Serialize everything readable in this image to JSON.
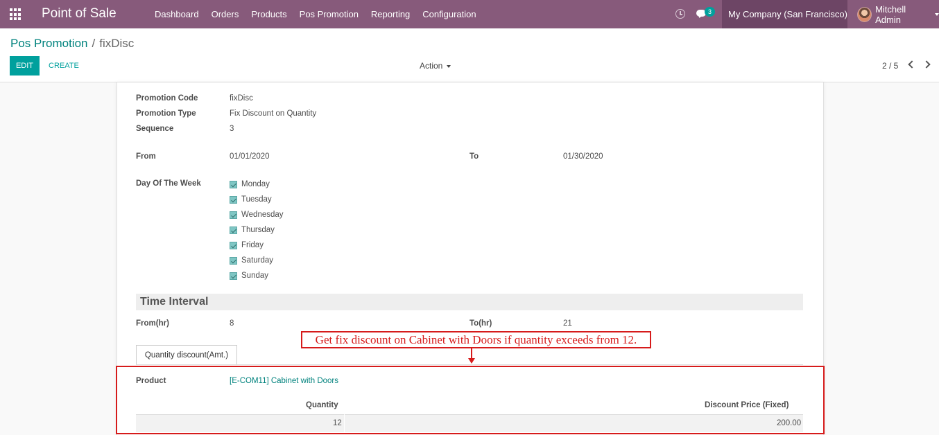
{
  "navbar": {
    "brand": "Point of Sale",
    "menu": [
      "Dashboard",
      "Orders",
      "Products",
      "Pos Promotion",
      "Reporting",
      "Configuration"
    ],
    "chat_count": "3",
    "company": "My Company (San Francisco)",
    "user": "Mitchell Admin"
  },
  "control": {
    "breadcrumb_parent": "Pos Promotion",
    "breadcrumb_separator": "/",
    "breadcrumb_current": "fixDisc",
    "edit_label": "EDIT",
    "create_label": "CREATE",
    "action_label": "Action",
    "pager": "2 / 5"
  },
  "form": {
    "promotion_code_label": "Promotion Code",
    "promotion_code": "fixDisc",
    "promotion_type_label": "Promotion Type",
    "promotion_type": "Fix Discount on Quantity",
    "sequence_label": "Sequence",
    "sequence": "3",
    "from_label": "From",
    "from": "01/01/2020",
    "to_label": "To",
    "to": "01/30/2020",
    "day_of_week_label": "Day Of The Week",
    "days": [
      "Monday",
      "Tuesday",
      "Wednesday",
      "Thursday",
      "Friday",
      "Saturday",
      "Sunday"
    ],
    "time_interval_title": "Time Interval",
    "from_hr_label": "From(hr)",
    "from_hr": "8",
    "to_hr_label": "To(hr)",
    "to_hr": "21"
  },
  "tab": {
    "label": "Quantity discount(Amt.)",
    "product_label": "Product",
    "product": "[E-COM11] Cabinet with Doors",
    "columns": [
      "Quantity",
      "Discount Price (Fixed)"
    ],
    "rows": [
      {
        "quantity": "12",
        "discount": "200.00"
      }
    ]
  },
  "annotation": {
    "text": "Get fix discount on Cabinet with Doors if quantity exceeds from 12."
  },
  "colors": {
    "navbar": "#875a7b",
    "accent": "#00a09d",
    "annotation": "#d61b1b"
  }
}
